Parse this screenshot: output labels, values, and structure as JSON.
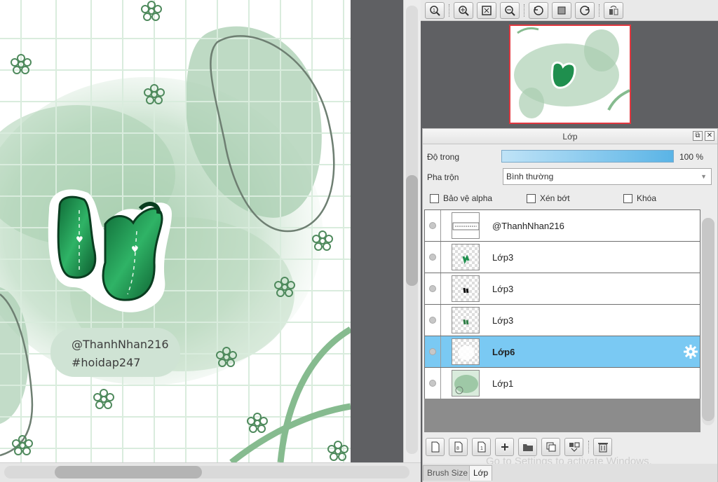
{
  "canvas": {
    "handle_name": "@ThanhNhan216",
    "hashtag": "#hoidap247"
  },
  "navigator": {
    "toolbar_icons": [
      "zoom-fit-icon",
      "zoom-in-icon",
      "fit-window-icon",
      "zoom-out-icon",
      "rotate-left-icon",
      "actual-size-icon",
      "rotate-right-icon",
      "flip-icon"
    ]
  },
  "layer_panel": {
    "title": "Lớp",
    "opacity_label": "Độ trong",
    "opacity_value": "100 %",
    "opacity_fraction": 1.0,
    "blend_label": "Pha trộn",
    "blend_value": "Bình thường",
    "protect_alpha_label": "Bảo vệ alpha",
    "clipping_label": "Xén bớt",
    "lock_label": "Khóa",
    "layers": [
      {
        "name": "@ThanhNhan216",
        "selected": false
      },
      {
        "name": "Lớp3",
        "selected": false
      },
      {
        "name": "Lớp3",
        "selected": false
      },
      {
        "name": "Lớp3",
        "selected": false
      },
      {
        "name": "Lớp6",
        "selected": true
      },
      {
        "name": "Lớp1",
        "selected": false
      }
    ],
    "bottom_toolbar_icons": [
      "new-layer-icon",
      "new-layer-8bit-icon",
      "new-layer-1bit-icon",
      "add-layer-icon",
      "folder-icon",
      "duplicate-layer-icon",
      "merge-layer-icon",
      "delete-layer-icon"
    ]
  },
  "tabs": {
    "brush_size": "Brush Size",
    "layer": "Lớp"
  },
  "watermark": "Go to Settings to activate Windows.",
  "colors": {
    "accent_selected": "#7ac9f3",
    "sticker_green": "#1f8f4e",
    "pale_green": "#bcd9c2",
    "nav_border": "#e2373f"
  }
}
